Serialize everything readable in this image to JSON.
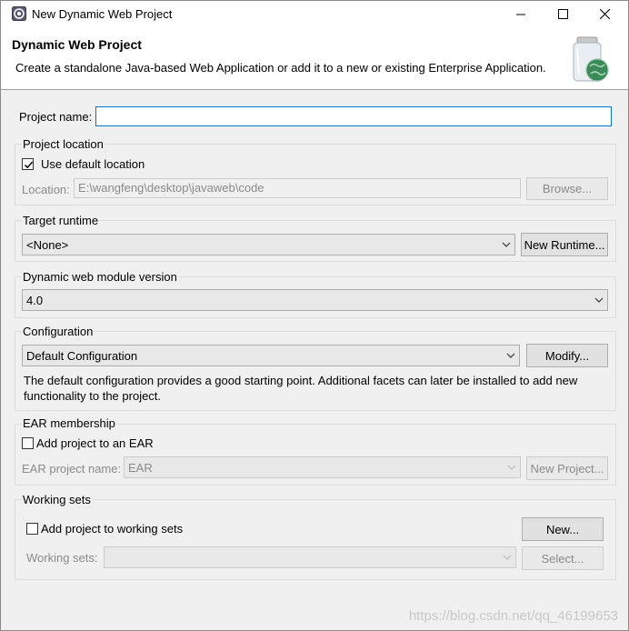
{
  "window": {
    "title": "New Dynamic Web Project"
  },
  "header": {
    "title": "Dynamic Web Project",
    "description": "Create a standalone Java-based Web Application or add it to a new or existing Enterprise Application."
  },
  "project_name": {
    "label": "Project name:",
    "value": ""
  },
  "project_location": {
    "group_title": "Project location",
    "use_default_label": "Use default location",
    "use_default_checked": true,
    "location_label": "Location:",
    "location_value": "E:\\wangfeng\\desktop\\javaweb\\code",
    "browse_label": "Browse..."
  },
  "target_runtime": {
    "group_title": "Target runtime",
    "selected": "<None>",
    "new_runtime_label": "New Runtime..."
  },
  "module_version": {
    "group_title": "Dynamic web module version",
    "selected": "4.0"
  },
  "configuration": {
    "group_title": "Configuration",
    "selected": "Default Configuration",
    "modify_label": "Modify...",
    "description_line1": "The default configuration provides a good starting point. Additional facets can later be installed to add new",
    "description_line2": "functionality to the project."
  },
  "ear_membership": {
    "group_title": "EAR membership",
    "add_label": "Add project to an EAR",
    "add_checked": false,
    "project_name_label": "EAR project name:",
    "project_name_value": "EAR",
    "new_project_label": "New Project..."
  },
  "working_sets": {
    "group_title": "Working sets",
    "add_label": "Add project to working sets",
    "add_checked": false,
    "new_label": "New...",
    "sets_label": "Working sets:",
    "sets_value": "",
    "select_label": "Select..."
  },
  "watermark": "https://blog.csdn.net/qq_46199653",
  "icons": {
    "app": "eclipse-icon",
    "header": "web-project-jar-icon",
    "minimize": "minimize-icon",
    "maximize": "maximize-icon",
    "close": "close-icon",
    "dropdown": "chevron-down-icon",
    "check": "checkmark-icon"
  }
}
